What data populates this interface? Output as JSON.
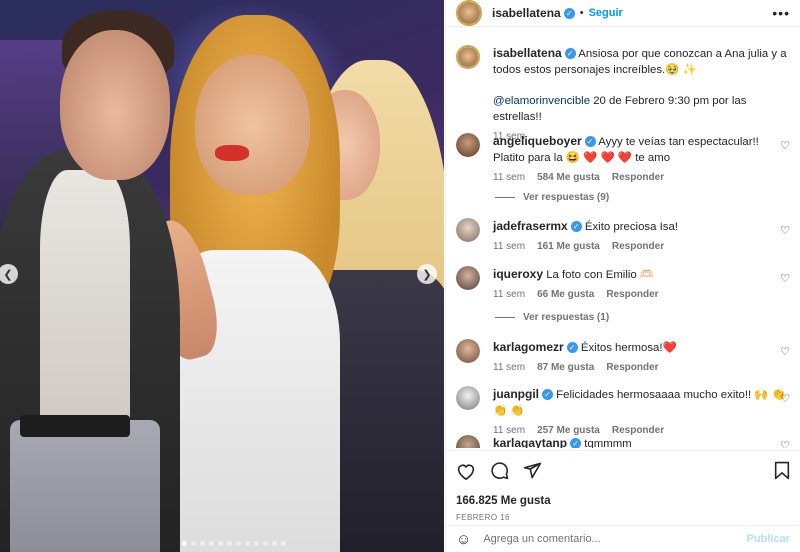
{
  "post": {
    "username": "isabellatena",
    "follow_label": "Seguir",
    "separator": "•",
    "more_label": "•••"
  },
  "caption": {
    "username": "isabellatena",
    "text": "Ansiosa por que conozcan a Ana julia y a todos estos personajes increíbles.🥹 ✨",
    "mention": "@elamorinvencible",
    "text2": " 20 de Febrero 9:30 pm por las estrellas!!",
    "time": "11 sem"
  },
  "comments": [
    {
      "user": "angeliqueboyer",
      "verified": true,
      "text": "Ayyy te veías tan espectacular!! Platito para la 😆 ❤️ ❤️ ❤️ te amo",
      "time": "11 sem",
      "likes": "584 Me gusta",
      "reply": "Responder",
      "replies": "Ver respuestas (9)"
    },
    {
      "user": "jadefrasermx",
      "verified": true,
      "text": "Éxito preciosa Isa!",
      "time": "11 sem",
      "likes": "161 Me gusta",
      "reply": "Responder"
    },
    {
      "user": "iqueroxy",
      "verified": false,
      "text": "La foto con Emilio 🫶🏻",
      "time": "11 sem",
      "likes": "66 Me gusta",
      "reply": "Responder",
      "replies": "Ver respuestas (1)"
    },
    {
      "user": "karlagomezr",
      "verified": true,
      "text": "Éxitos hermosa!❤️",
      "time": "11 sem",
      "likes": "87 Me gusta",
      "reply": "Responder"
    },
    {
      "user": "juanpgil",
      "verified": true,
      "text": "Felicidades hermosaaaa mucho exito!! 🙌 👏 👏 👏",
      "time": "11 sem",
      "likes": "257 Me gusta",
      "reply": "Responder"
    },
    {
      "user": "karlagaytanp",
      "verified": true,
      "text": "tqmmmm"
    }
  ],
  "actions": {
    "likes": "166.825 Me gusta",
    "date": "FEBRERO 16",
    "icons": [
      "heart-icon",
      "comment-icon",
      "share-icon",
      "save-icon"
    ]
  },
  "comment_box": {
    "placeholder": "Agrega un comentario...",
    "publish_label": "Publicar"
  },
  "carousel": {
    "slides": 12,
    "active": 1
  }
}
